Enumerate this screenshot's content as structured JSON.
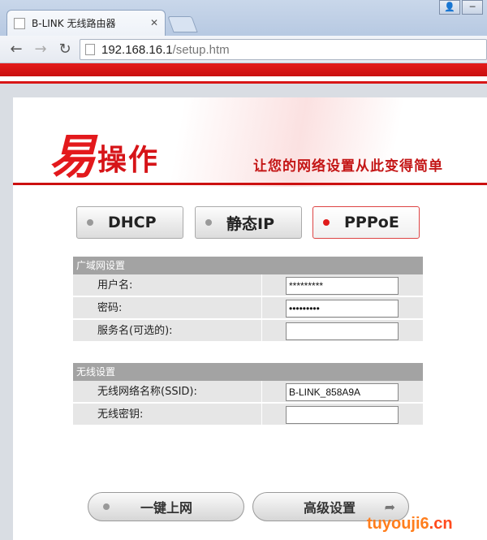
{
  "browser": {
    "tab_title": "B-LINK 无线路由器",
    "url_host": "192.168.16.1",
    "url_path": "/setup.htm"
  },
  "banner": {
    "logo_big": "易",
    "logo_small": "操作",
    "slogan": "让您的网络设置从此变得简单"
  },
  "modes": [
    {
      "label": "DHCP",
      "active": false
    },
    {
      "label": "静态IP",
      "active": false
    },
    {
      "label": "PPPoE",
      "active": true
    }
  ],
  "wan": {
    "heading": "广域网设置",
    "username_label": "用户名:",
    "username_value": "*********",
    "password_label": "密码:",
    "password_value": "•••••••••",
    "service_label": "服务名(可选的):",
    "service_value": ""
  },
  "wireless": {
    "heading": "无线设置",
    "ssid_label": "无线网络名称(SSID):",
    "ssid_value": "B-LINK_858A9A",
    "key_label": "无线密钥:",
    "key_value": ""
  },
  "actions": {
    "connect_label": "一键上网",
    "advanced_label": "高级设置"
  },
  "watermark": {
    "text1": "tuyouji6",
    "text2": ".cn"
  },
  "colors": {
    "accent_red": "#e01b1b",
    "section_gray": "#a3a3a3"
  }
}
